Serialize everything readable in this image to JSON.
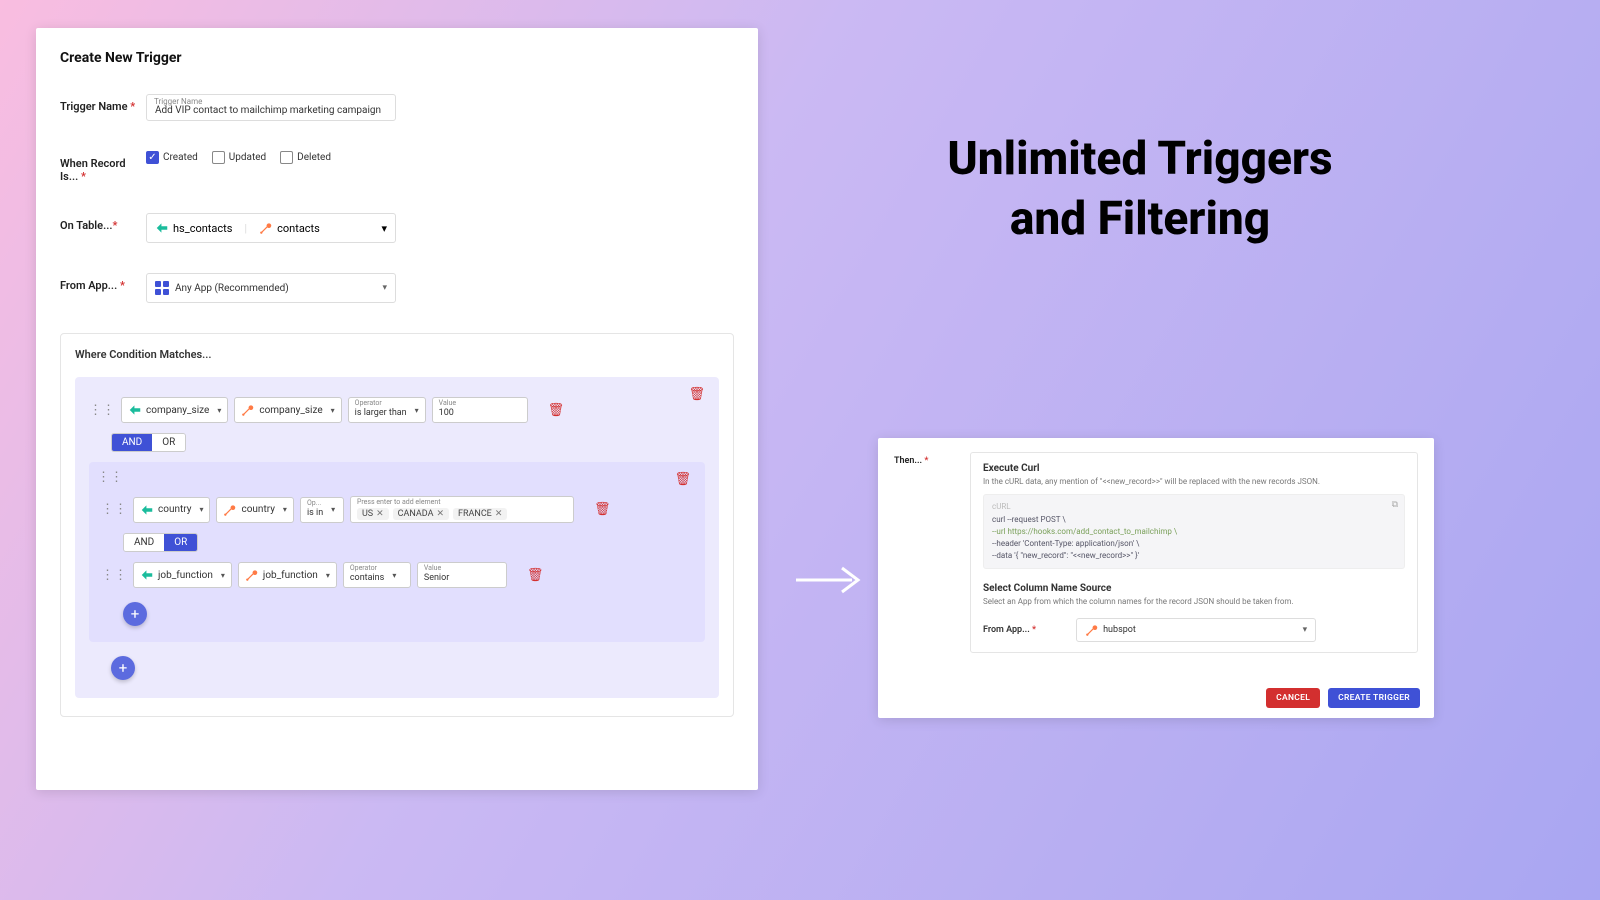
{
  "headline_line1": "Unlimited Triggers",
  "headline_line2": "and Filtering",
  "left": {
    "title": "Create New Trigger",
    "trigger_name_label": "Trigger Name",
    "trigger_name_floating": "Trigger Name",
    "trigger_name_value": "Add VIP contact to mailchimp marketing campaign",
    "when_label": "When Record Is...",
    "checks": {
      "created": "Created",
      "updated": "Updated",
      "deleted": "Deleted"
    },
    "on_table_label": "On Table...",
    "on_table_left": "hs_contacts",
    "on_table_right": "contacts",
    "from_app_label": "From App...",
    "from_app_value": "Any App (Recommended)",
    "cond_label": "Where Condition Matches...",
    "rule1": {
      "col_a": "company_size",
      "col_b": "company_size",
      "op_lbl": "Operator",
      "op_val": "is larger than",
      "val_lbl": "Value",
      "val": "100"
    },
    "and_or1": {
      "and": "AND",
      "or": "OR"
    },
    "rule2": {
      "col_a": "country",
      "col_b": "country",
      "op_lbl": "Op...",
      "op_val": "is in",
      "placeholder": "Press enter to add element",
      "tags": [
        "US",
        "CANADA",
        "FRANCE"
      ]
    },
    "and_or2": {
      "and": "AND",
      "or": "OR"
    },
    "rule3": {
      "col_a": "job_function",
      "col_b": "job_function",
      "op_lbl": "Operator",
      "op_val": "contains",
      "val_lbl": "Value",
      "val": "Senior"
    }
  },
  "right": {
    "then_label": "Then...",
    "exec_title": "Execute Curl",
    "exec_desc": "In the cURL data, any mention of \"<<new_record>>\" will be replaced with the new records JSON.",
    "code_label": "cURL",
    "code_l1": "curl --request POST \\",
    "code_l2": "--url https://hooks.com/add_contact_to_mailchimp \\",
    "code_l3": "--header 'Content-Type: application/json' \\",
    "code_l4": "--data '{ \"new_record\": \"<<new_record>>\" }'",
    "colsrc_title": "Select Column Name Source",
    "colsrc_desc": "Select an App from which the column names for the record JSON should be taken from.",
    "from_app_label": "From App...",
    "from_app_value": "hubspot",
    "cancel": "CANCEL",
    "create": "CREATE TRIGGER"
  }
}
